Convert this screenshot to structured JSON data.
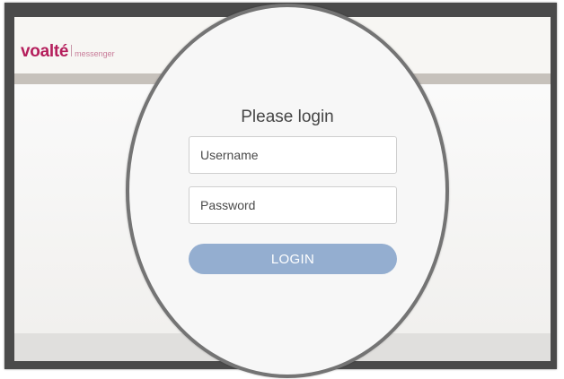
{
  "brand": {
    "name": "voalté",
    "tagline": "messenger",
    "color": "#b51f5c"
  },
  "login": {
    "title": "Please login",
    "username_placeholder": "Username",
    "password_placeholder": "Password",
    "button_label": "LOGIN",
    "button_color": "#94aed0"
  }
}
